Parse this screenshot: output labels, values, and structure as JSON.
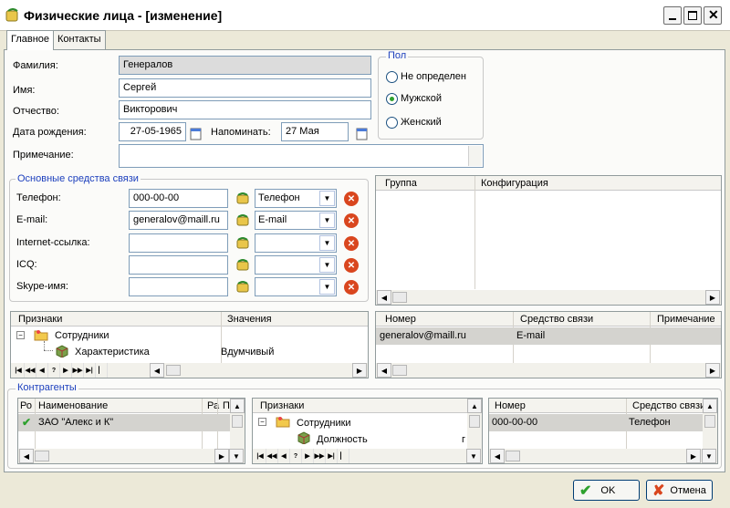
{
  "window": {
    "title": "Физические лица - [изменение]"
  },
  "tabs": [
    {
      "label": "Главное"
    },
    {
      "label": "Контакты"
    }
  ],
  "form": {
    "last_name_label": "Фамилия:",
    "last_name": "Генералов",
    "first_name_label": "Имя:",
    "first_name": "Сергей",
    "patronymic_label": "Отчество:",
    "patronymic": "Викторович",
    "birth_label": "Дата рождения:",
    "birth_date": "27-05-1965",
    "remind_label": "Напоминать:",
    "remind_date": "27 Мая",
    "note_label": "Примечание:",
    "note": ""
  },
  "gender": {
    "title": "Пол",
    "options": [
      "Не определен",
      "Мужской",
      "Женский"
    ],
    "selected": "Мужской"
  },
  "contacts": {
    "title": "Основные средства связи",
    "rows": [
      {
        "label": "Телефон:",
        "value": "000-00-00",
        "type": "Телефон"
      },
      {
        "label": "E-mail:",
        "value": "generalov@maill.ru",
        "type": "E-mail"
      },
      {
        "label": "Internet-ссылка:",
        "value": "",
        "type": ""
      },
      {
        "label": "ICQ:",
        "value": "",
        "type": ""
      },
      {
        "label": "Skype-имя:",
        "value": "",
        "type": ""
      }
    ]
  },
  "groups_grid": {
    "columns": [
      "Группа",
      "Конфигурация"
    ]
  },
  "attrs_grid": {
    "columns": [
      "Признаки",
      "Значения"
    ],
    "tree": [
      {
        "label": "Сотрудники",
        "value": ""
      },
      {
        "label": "Характеристика",
        "value": "Вдумчивый"
      }
    ]
  },
  "comm_grid": {
    "columns": [
      "Номер",
      "Средство связи",
      "Примечание"
    ],
    "rows": [
      {
        "number": "generalov@maill.ru",
        "type": "E-mail",
        "note": ""
      }
    ]
  },
  "counterparties": {
    "title": "Контрагенты",
    "left": {
      "columns": [
        "Ро",
        "Наименование",
        "Ра",
        "П"
      ],
      "rows": [
        {
          "name": "ЗАО \"Алекс и К\""
        }
      ]
    },
    "middle": {
      "columns": [
        "Признаки"
      ],
      "tree": [
        {
          "label": "Сотрудники"
        },
        {
          "label": "Должность",
          "tail": "г"
        }
      ]
    },
    "right": {
      "columns": [
        "Номер",
        "Средство связи"
      ],
      "rows": [
        {
          "number": "000-00-00",
          "type": "Телефон"
        }
      ]
    }
  },
  "buttons": {
    "ok": "OK",
    "cancel": "Отмена"
  },
  "nav_symbols": [
    "|◀",
    "◀◀",
    "◀",
    "?",
    "▶",
    "▶▶",
    "▶|",
    "▏"
  ],
  "colors": {
    "accent": "#1c3fbd",
    "delete": "#d9461e",
    "check": "#2ea12e"
  }
}
